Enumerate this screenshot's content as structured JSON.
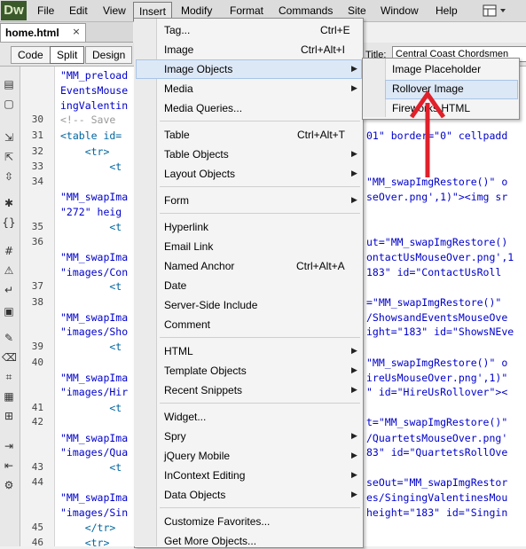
{
  "app": {
    "logo": "Dw"
  },
  "menubar": [
    "File",
    "Edit",
    "View",
    "Insert",
    "Modify",
    "Format",
    "Commands",
    "Site",
    "Window",
    "Help"
  ],
  "document_tab": {
    "label": "home.html",
    "close": "×"
  },
  "toolbar": {
    "views": [
      "Code",
      "Split",
      "Design"
    ],
    "title_label": "Title:",
    "title_value": "Central Coast Chordsmen"
  },
  "line_numbers": [
    "30",
    "31",
    "32",
    "33",
    "34",
    "35",
    "36",
    "37",
    "38",
    "39",
    "40",
    "41",
    "42",
    "43",
    "44",
    "45",
    "46"
  ],
  "code_left": [
    "\"MM_preload",
    "EventsMouse",
    "ingValentin",
    "<!-- Save ",
    "<table id=",
    "    <tr>",
    "        <t",
    "",
    "\"MM_swapIma",
    "\"272\" heig",
    "        <t",
    "",
    "\"MM_swapIma",
    "\"images/Con",
    "        <t",
    "",
    "\"MM_swapIma",
    "\"images/Sho",
    "        <t",
    "",
    "\"MM_swapIma",
    "\"images/Hir",
    "        <t",
    "",
    "\"MM_swapIma",
    "\"images/Qua",
    "        <t",
    "",
    "\"MM_swapIma",
    "\"images/Sin",
    "    </tr>",
    "    <tr>"
  ],
  "code_right": [
    "01\" border=\"0\" cellpadd",
    "\"MM_swapImgRestore()\" o",
    "seOver.png',1)\"><img sr",
    "ut=\"MM_swapImgRestore()",
    "ontactUsMouseOver.png',1",
    "183\" id=\"ContactUsRoll",
    "=\"MM_swapImgRestore()\"",
    "/ShowsandEventsMouseOve",
    "ight=\"183\" id=\"ShowsNEve",
    "\"MM_swapImgRestore()\" o",
    "ireUsMouseOver.png',1)\"",
    "\" id=\"HireUsRollover\"><",
    "t=\"MM_swapImgRestore()\"",
    "/QuartetsMouseOver.png'",
    "83\" id=\"QuartetsRollOve",
    "seOut=\"MM_swapImgRestor",
    "es/SingingValentinesMou",
    "height=\"183\" id=\"Singin"
  ],
  "insert_menu": {
    "items": [
      {
        "label": "Tag...",
        "shortcut": "Ctrl+E",
        "submenu": false
      },
      {
        "label": "Image",
        "shortcut": "Ctrl+Alt+I",
        "submenu": false
      },
      {
        "label": "Image Objects",
        "shortcut": "",
        "submenu": true
      },
      {
        "label": "Media",
        "shortcut": "",
        "submenu": true
      },
      {
        "label": "Media Queries...",
        "shortcut": "",
        "submenu": false
      },
      {
        "label": "Table",
        "shortcut": "Ctrl+Alt+T",
        "submenu": false
      },
      {
        "label": "Table Objects",
        "shortcut": "",
        "submenu": true
      },
      {
        "label": "Layout Objects",
        "shortcut": "",
        "submenu": true
      },
      {
        "label": "Form",
        "shortcut": "",
        "submenu": true
      },
      {
        "label": "Hyperlink",
        "shortcut": "",
        "submenu": false
      },
      {
        "label": "Email Link",
        "shortcut": "",
        "submenu": false
      },
      {
        "label": "Named Anchor",
        "shortcut": "Ctrl+Alt+A",
        "submenu": false
      },
      {
        "label": "Date",
        "shortcut": "",
        "submenu": false
      },
      {
        "label": "Server-Side Include",
        "shortcut": "",
        "submenu": false
      },
      {
        "label": "Comment",
        "shortcut": "",
        "submenu": false
      },
      {
        "label": "HTML",
        "shortcut": "",
        "submenu": true
      },
      {
        "label": "Template Objects",
        "shortcut": "",
        "submenu": true
      },
      {
        "label": "Recent Snippets",
        "shortcut": "",
        "submenu": true
      },
      {
        "label": "Widget...",
        "shortcut": "",
        "submenu": false
      },
      {
        "label": "Spry",
        "shortcut": "",
        "submenu": true
      },
      {
        "label": "jQuery Mobile",
        "shortcut": "",
        "submenu": true
      },
      {
        "label": "InContext Editing",
        "shortcut": "",
        "submenu": true
      },
      {
        "label": "Data Objects",
        "shortcut": "",
        "submenu": true
      },
      {
        "label": "Customize Favorites...",
        "shortcut": "",
        "submenu": false
      },
      {
        "label": "Get More Objects...",
        "shortcut": "",
        "submenu": false
      }
    ]
  },
  "image_objects_submenu": [
    "Image Placeholder",
    "Rollover Image",
    "Fireworks HTML"
  ],
  "colors": {
    "highlight": "#dde8f6",
    "arrow": "#e0202a",
    "string": "#0000cc"
  }
}
